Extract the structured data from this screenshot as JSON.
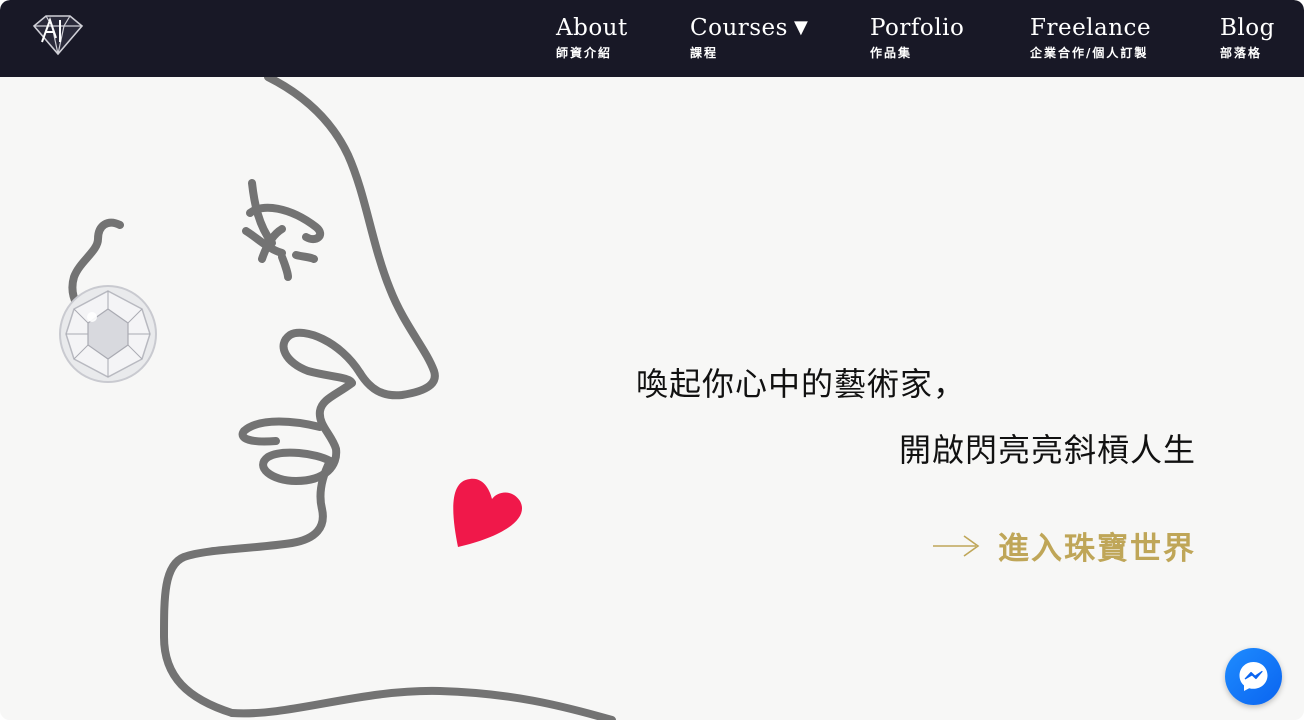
{
  "nav": {
    "logo_icon": "diamond-ak-logo",
    "items": [
      {
        "en": "About",
        "zh": "師資介紹"
      },
      {
        "en": "Courses",
        "zh": "課程",
        "caret": "▼"
      },
      {
        "en": "Porfolio",
        "zh": "作品集"
      },
      {
        "en": "Freelance",
        "zh": "企業合作/個人訂製"
      },
      {
        "en": "Blog",
        "zh": "部落格"
      }
    ]
  },
  "hero": {
    "headline_line1": "喚起你心中的藝術家，",
    "headline_line2": "開啟閃亮亮斜槓人生",
    "cta_label": "進入珠寶世界",
    "cta_icon": "long-arrow-right-icon",
    "illustration_icon": "face-line-art-illustration"
  },
  "chat_widget": {
    "icon": "messenger-icon"
  },
  "colors": {
    "nav_bg": "#181826",
    "hero_bg": "#f7f7f6",
    "accent_gold": "#bfa658",
    "heart_red": "#f0184a",
    "messenger_blue": "#0a64f0"
  }
}
